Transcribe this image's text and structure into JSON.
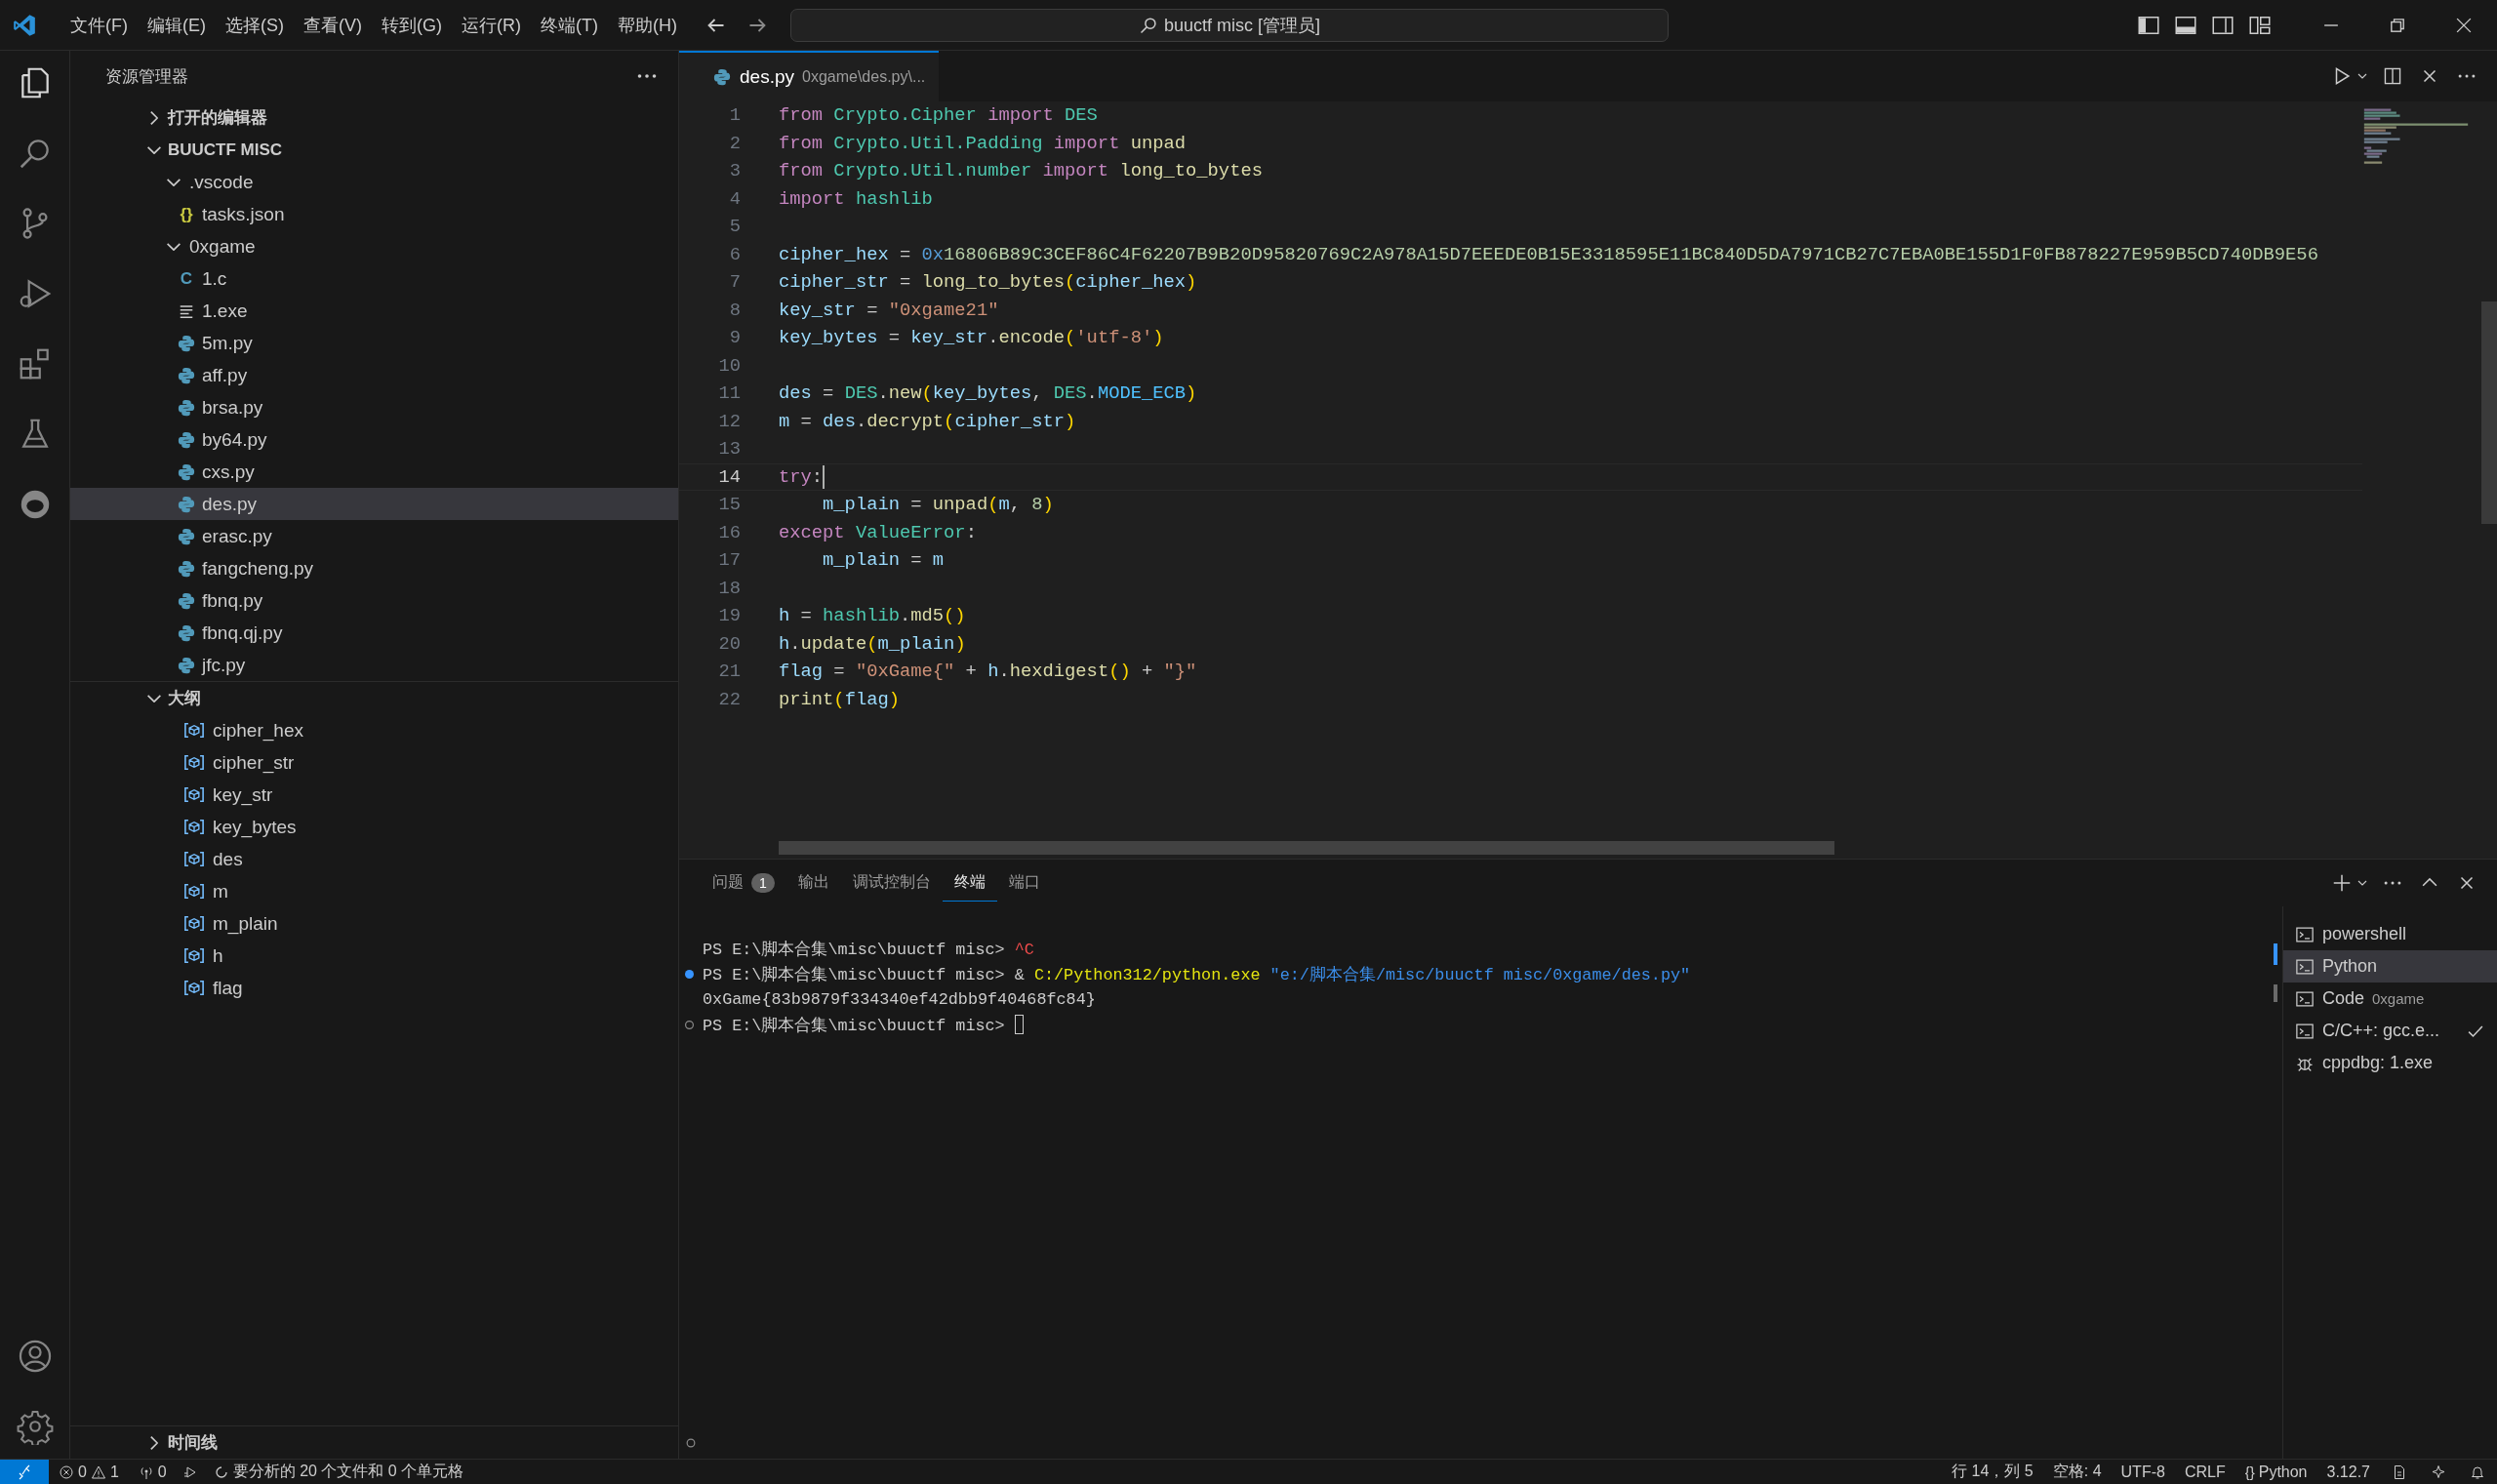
{
  "title_bar": {
    "menu": [
      "文件(F)",
      "编辑(E)",
      "选择(S)",
      "查看(V)",
      "转到(G)",
      "运行(R)",
      "终端(T)",
      "帮助(H)"
    ],
    "command_center": "buuctf misc [管理员]"
  },
  "explorer": {
    "title": "资源管理器",
    "sections": [
      {
        "label": "打开的编辑器",
        "expanded": false
      },
      {
        "label": "BUUCTF MISC",
        "expanded": true,
        "children": [
          {
            "name": ".vscode",
            "kind": "folder",
            "expanded": true,
            "children": [
              {
                "name": "tasks.json",
                "kind": "json",
                "glyph": "{}",
                "selected": false
              }
            ]
          },
          {
            "name": "0xgame",
            "kind": "folder",
            "expanded": true,
            "children": [
              {
                "name": "1.c",
                "kind": "c",
                "glyph": "C",
                "selected": false
              },
              {
                "name": "1.exe",
                "kind": "binary",
                "selected": false
              },
              {
                "name": "5m.py",
                "kind": "python",
                "selected": false
              },
              {
                "name": "aff.py",
                "kind": "python",
                "selected": false
              },
              {
                "name": "brsa.py",
                "kind": "python",
                "selected": false
              },
              {
                "name": "by64.py",
                "kind": "python",
                "selected": false
              },
              {
                "name": "cxs.py",
                "kind": "python",
                "selected": false
              },
              {
                "name": "des.py",
                "kind": "python",
                "selected": true
              },
              {
                "name": "erasc.py",
                "kind": "python",
                "selected": false
              },
              {
                "name": "fangcheng.py",
                "kind": "python",
                "selected": false
              },
              {
                "name": "fbnq.py",
                "kind": "python",
                "selected": false
              },
              {
                "name": "fbnq.qj.py",
                "kind": "python",
                "selected": false
              },
              {
                "name": "jfc.py",
                "kind": "python",
                "selected": false
              }
            ]
          }
        ]
      }
    ]
  },
  "outline": {
    "label": "大纲",
    "expanded": true,
    "items": [
      {
        "name": "cipher_hex"
      },
      {
        "name": "cipher_str"
      },
      {
        "name": "key_str"
      },
      {
        "name": "key_bytes"
      },
      {
        "name": "des"
      },
      {
        "name": "m"
      },
      {
        "name": "m_plain"
      },
      {
        "name": "h"
      },
      {
        "name": "flag"
      }
    ]
  },
  "timeline": {
    "label": "时间线",
    "expanded": false
  },
  "editor": {
    "tab": {
      "name": "des.py",
      "description": "0xgame\\des.py\\..."
    },
    "lines": [
      {
        "number": "1",
        "current": false,
        "tokens": [
          {
            "kind": "keyword",
            "text": "from "
          },
          {
            "kind": "module",
            "text": "Crypto.Cipher "
          },
          {
            "kind": "keyword",
            "text": "import "
          },
          {
            "kind": "class",
            "text": "DES"
          }
        ]
      },
      {
        "number": "2",
        "current": false,
        "tokens": [
          {
            "kind": "keyword",
            "text": "from "
          },
          {
            "kind": "module",
            "text": "Crypto.Util.Padding "
          },
          {
            "kind": "keyword",
            "text": "import "
          },
          {
            "kind": "function",
            "text": "unpad"
          }
        ]
      },
      {
        "number": "3",
        "current": false,
        "tokens": [
          {
            "kind": "keyword",
            "text": "from "
          },
          {
            "kind": "module",
            "text": "Crypto.Util.number "
          },
          {
            "kind": "keyword",
            "text": "import "
          },
          {
            "kind": "function",
            "text": "long_to_bytes"
          }
        ]
      },
      {
        "number": "4",
        "current": false,
        "tokens": [
          {
            "kind": "keyword",
            "text": "import "
          },
          {
            "kind": "module",
            "text": "hashlib"
          }
        ]
      },
      {
        "number": "5",
        "current": false
      },
      {
        "number": "6",
        "current": false,
        "tokens": [
          {
            "kind": "variable",
            "text": "cipher_hex"
          },
          {
            "kind": "plain",
            "text": " = "
          },
          {
            "kind": "prefix",
            "text": "0x"
          },
          {
            "kind": "number",
            "text": "16806B89C3CEF86C4F62207B9B20D95820769C2A978A15D7EEEDE0B15E3318595E11BC840D5DA7971CB27C7EBA0BE155D1F0FB878227E959B5CD740DB9E56"
          }
        ]
      },
      {
        "number": "7",
        "current": false,
        "tokens": [
          {
            "kind": "variable",
            "text": "cipher_str"
          },
          {
            "kind": "plain",
            "text": " = "
          },
          {
            "kind": "function",
            "text": "long_to_bytes"
          },
          {
            "kind": "bracket",
            "text": "("
          },
          {
            "kind": "variable",
            "text": "cipher_hex"
          },
          {
            "kind": "bracket",
            "text": ")"
          }
        ]
      },
      {
        "number": "8",
        "current": false,
        "tokens": [
          {
            "kind": "variable",
            "text": "key_str"
          },
          {
            "kind": "plain",
            "text": " = "
          },
          {
            "kind": "string",
            "text": "\"0xgame21\""
          }
        ]
      },
      {
        "number": "9",
        "current": false,
        "tokens": [
          {
            "kind": "variable",
            "text": "key_bytes"
          },
          {
            "kind": "plain",
            "text": " = "
          },
          {
            "kind": "variable",
            "text": "key_str"
          },
          {
            "kind": "plain",
            "text": "."
          },
          {
            "kind": "function",
            "text": "encode"
          },
          {
            "kind": "bracket",
            "text": "("
          },
          {
            "kind": "string",
            "text": "'utf-8'"
          },
          {
            "kind": "bracket",
            "text": ")"
          }
        ]
      },
      {
        "number": "10",
        "current": false
      },
      {
        "number": "11",
        "current": false,
        "tokens": [
          {
            "kind": "variable",
            "text": "des"
          },
          {
            "kind": "plain",
            "text": " = "
          },
          {
            "kind": "class",
            "text": "DES"
          },
          {
            "kind": "plain",
            "text": "."
          },
          {
            "kind": "function",
            "text": "new"
          },
          {
            "kind": "bracket",
            "text": "("
          },
          {
            "kind": "variable",
            "text": "key_bytes"
          },
          {
            "kind": "plain",
            "text": ", "
          },
          {
            "kind": "class",
            "text": "DES"
          },
          {
            "kind": "plain",
            "text": "."
          },
          {
            "kind": "constant",
            "text": "MODE_ECB"
          },
          {
            "kind": "bracket",
            "text": ")"
          }
        ]
      },
      {
        "number": "12",
        "current": false,
        "tokens": [
          {
            "kind": "variable",
            "text": "m"
          },
          {
            "kind": "plain",
            "text": " = "
          },
          {
            "kind": "variable",
            "text": "des"
          },
          {
            "kind": "plain",
            "text": "."
          },
          {
            "kind": "function",
            "text": "decrypt"
          },
          {
            "kind": "bracket",
            "text": "("
          },
          {
            "kind": "variable",
            "text": "cipher_str"
          },
          {
            "kind": "bracket",
            "text": ")"
          }
        ]
      },
      {
        "number": "13",
        "current": false
      },
      {
        "number": "14",
        "current": true,
        "tokens": [
          {
            "kind": "keyword",
            "text": "try"
          },
          {
            "kind": "plain",
            "text": ":"
          }
        ]
      },
      {
        "number": "15",
        "current": false,
        "tokens": [
          {
            "kind": "variable",
            "text": "    m_plain"
          },
          {
            "kind": "plain",
            "text": " = "
          },
          {
            "kind": "function",
            "text": "unpad"
          },
          {
            "kind": "bracket",
            "text": "("
          },
          {
            "kind": "variable",
            "text": "m"
          },
          {
            "kind": "plain",
            "text": ", "
          },
          {
            "kind": "number",
            "text": "8"
          },
          {
            "kind": "bracket",
            "text": ")"
          }
        ]
      },
      {
        "number": "16",
        "current": false,
        "tokens": [
          {
            "kind": "keyword",
            "text": "except "
          },
          {
            "kind": "class",
            "text": "ValueError"
          },
          {
            "kind": "plain",
            "text": ":"
          }
        ]
      },
      {
        "number": "17",
        "current": false,
        "tokens": [
          {
            "kind": "variable",
            "text": "    m_plain"
          },
          {
            "kind": "plain",
            "text": " = "
          },
          {
            "kind": "variable",
            "text": "m"
          }
        ]
      },
      {
        "number": "18",
        "current": false
      },
      {
        "number": "19",
        "current": false,
        "tokens": [
          {
            "kind": "variable",
            "text": "h"
          },
          {
            "kind": "plain",
            "text": " = "
          },
          {
            "kind": "module",
            "text": "hashlib"
          },
          {
            "kind": "plain",
            "text": "."
          },
          {
            "kind": "function",
            "text": "md5"
          },
          {
            "kind": "bracket",
            "text": "()"
          }
        ]
      },
      {
        "number": "20",
        "current": false,
        "tokens": [
          {
            "kind": "variable",
            "text": "h"
          },
          {
            "kind": "plain",
            "text": "."
          },
          {
            "kind": "function",
            "text": "update"
          },
          {
            "kind": "bracket",
            "text": "("
          },
          {
            "kind": "variable",
            "text": "m_plain"
          },
          {
            "kind": "bracket",
            "text": ")"
          }
        ]
      },
      {
        "number": "21",
        "current": false,
        "tokens": [
          {
            "kind": "variable",
            "text": "flag"
          },
          {
            "kind": "plain",
            "text": " = "
          },
          {
            "kind": "string",
            "text": "\"0xGame{\""
          },
          {
            "kind": "plain",
            "text": " + "
          },
          {
            "kind": "variable",
            "text": "h"
          },
          {
            "kind": "plain",
            "text": "."
          },
          {
            "kind": "function",
            "text": "hexdigest"
          },
          {
            "kind": "bracket",
            "text": "()"
          },
          {
            "kind": "plain",
            "text": " + "
          },
          {
            "kind": "string",
            "text": "\"}\""
          }
        ]
      },
      {
        "number": "22",
        "current": false,
        "tokens": [
          {
            "kind": "function",
            "text": "print"
          },
          {
            "kind": "bracket",
            "text": "("
          },
          {
            "kind": "variable",
            "text": "flag"
          },
          {
            "kind": "bracket",
            "text": ")"
          }
        ]
      }
    ]
  },
  "panel": {
    "tabs": [
      {
        "label": "问题",
        "badge": "1",
        "selected": false
      },
      {
        "label": "输出",
        "selected": false
      },
      {
        "label": "调试控制台",
        "selected": false
      },
      {
        "label": "终端",
        "selected": true
      },
      {
        "label": "端口",
        "selected": false
      }
    ],
    "terminal_lines": [
      {
        "marked": false,
        "cursor": false,
        "tokens": [
          {
            "kind": "plain",
            "text": "PS E:\\脚本合集\\misc\\buuctf misc> "
          },
          {
            "kind": "error",
            "text": "^C"
          }
        ]
      },
      {
        "marked": true,
        "completed": true,
        "cursor": false,
        "tokens": [
          {
            "kind": "plain",
            "text": "PS E:\\脚本合集\\misc\\buuctf misc> & "
          },
          {
            "kind": "command",
            "text": "C:/Python312/python.exe"
          },
          {
            "kind": "string",
            "text": " \"e:/脚本合集/misc/buuctf misc/0xgame/des.py\""
          }
        ]
      },
      {
        "marked": false,
        "cursor": false,
        "tokens": [
          {
            "kind": "plain",
            "text": "0xGame{83b9879f334340ef42dbb9f40468fc84}"
          }
        ]
      },
      {
        "marked": true,
        "completed": false,
        "cursor": true,
        "tokens": [
          {
            "kind": "plain",
            "text": "PS E:\\脚本合集\\misc\\buuctf misc> "
          }
        ]
      }
    ],
    "terminals": [
      {
        "name": "powershell",
        "kind": "shell",
        "selected": false,
        "succeeded": false
      },
      {
        "name": "Python",
        "kind": "shell",
        "selected": true,
        "succeeded": false
      },
      {
        "name": "Code",
        "detail": "0xgame",
        "kind": "shell",
        "selected": false,
        "succeeded": false
      },
      {
        "name": "C/C++: gcc.e...",
        "kind": "shell",
        "selected": false,
        "succeeded": true
      },
      {
        "name": "cppdbg: 1.exe",
        "kind": "debug",
        "selected": false,
        "succeeded": false
      }
    ]
  },
  "status_bar": {
    "errors": "0",
    "warnings": "1",
    "ports": "0",
    "progress": "要分析的 20 个文件和 0 个单元格",
    "position": "行 14，列 5",
    "indentation": "空格: 4",
    "encoding": "UTF-8",
    "line_ending": "CRLF",
    "language_glyph": "{}",
    "language": "Python",
    "interpreter": "3.12.7"
  }
}
